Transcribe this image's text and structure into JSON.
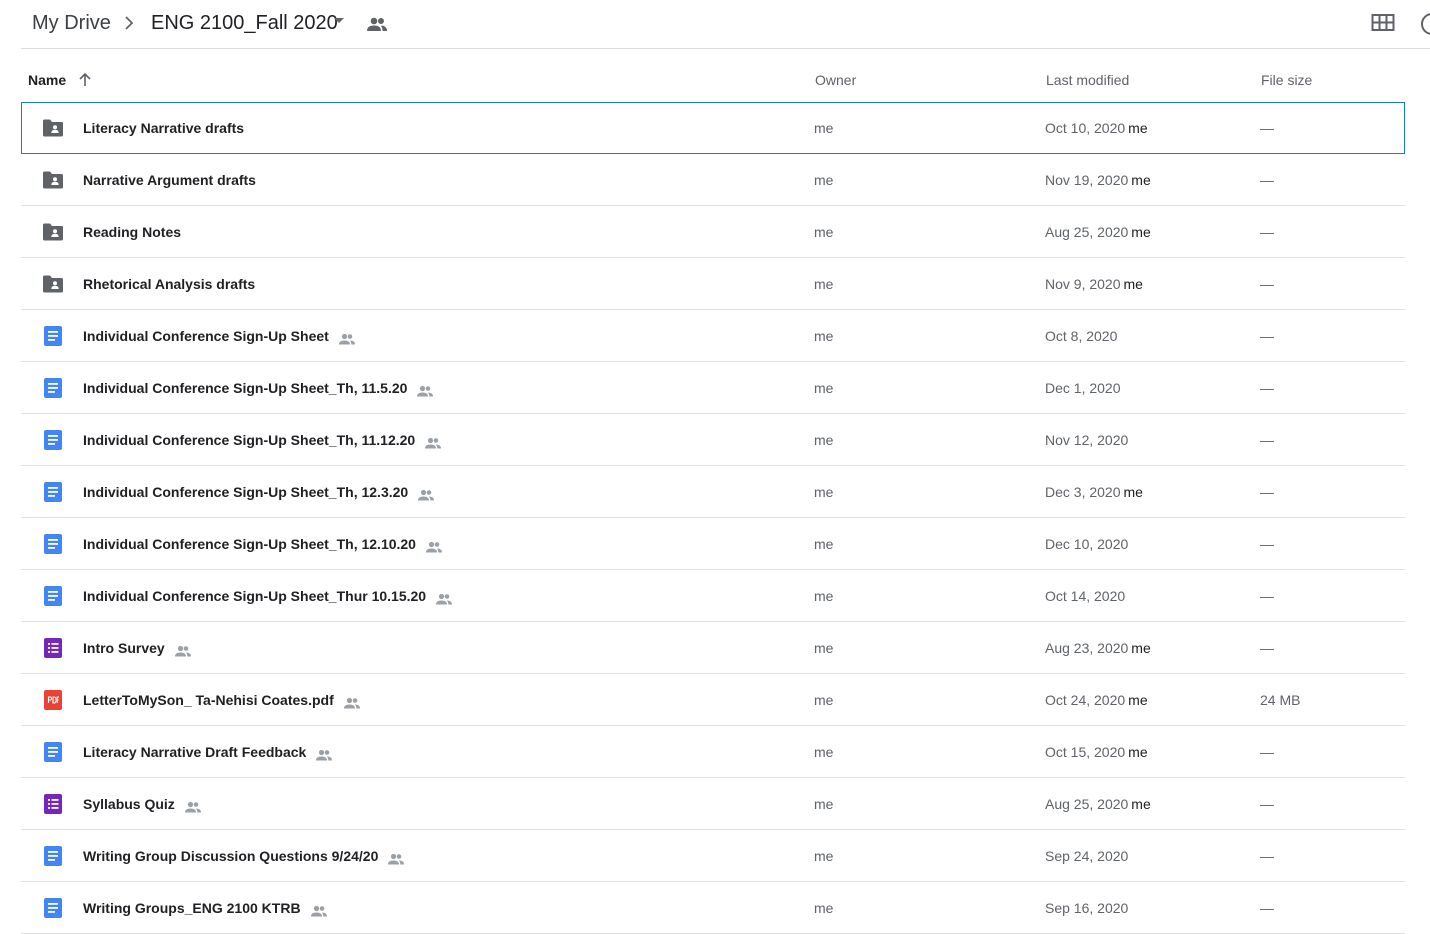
{
  "breadcrumb": {
    "root": "My Drive",
    "current": "ENG 2100_Fall 2020"
  },
  "columns": {
    "name": "Name",
    "owner": "Owner",
    "modified": "Last modified",
    "size": "File size"
  },
  "colors": {
    "accent": "#1a73e8",
    "doc": "#4285f4",
    "form": "#7627bb",
    "pdf": "#ea4335",
    "folder": "#5f6368"
  },
  "files": [
    {
      "type": "folder-shared-icon",
      "name": "Literacy Narrative drafts",
      "shared": false,
      "owner": "me",
      "modified": "Oct 10, 2020",
      "modified_by": "me",
      "size": "—",
      "selected": true
    },
    {
      "type": "folder-shared-icon",
      "name": "Narrative Argument drafts",
      "shared": false,
      "owner": "me",
      "modified": "Nov 19, 2020",
      "modified_by": "me",
      "size": "—"
    },
    {
      "type": "folder-shared-icon",
      "name": "Reading Notes",
      "shared": false,
      "owner": "me",
      "modified": "Aug 25, 2020",
      "modified_by": "me",
      "size": "—"
    },
    {
      "type": "folder-shared-icon",
      "name": "Rhetorical Analysis drafts",
      "shared": false,
      "owner": "me",
      "modified": "Nov 9, 2020",
      "modified_by": "me",
      "size": "—"
    },
    {
      "type": "google-doc-icon",
      "name": "Individual Conference Sign-Up Sheet",
      "shared": true,
      "owner": "me",
      "modified": "Oct 8, 2020",
      "modified_by": "",
      "size": "—"
    },
    {
      "type": "google-doc-icon",
      "name": "Individual Conference Sign-Up Sheet_Th, 11.5.20",
      "shared": true,
      "owner": "me",
      "modified": "Dec 1, 2020",
      "modified_by": "",
      "size": "—"
    },
    {
      "type": "google-doc-icon",
      "name": "Individual Conference Sign-Up Sheet_Th, 11.12.20",
      "shared": true,
      "owner": "me",
      "modified": "Nov 12, 2020",
      "modified_by": "",
      "size": "—"
    },
    {
      "type": "google-doc-icon",
      "name": "Individual Conference Sign-Up Sheet_Th, 12.3.20",
      "shared": true,
      "owner": "me",
      "modified": "Dec 3, 2020",
      "modified_by": "me",
      "size": "—"
    },
    {
      "type": "google-doc-icon",
      "name": "Individual Conference Sign-Up Sheet_Th, 12.10.20",
      "shared": true,
      "owner": "me",
      "modified": "Dec 10, 2020",
      "modified_by": "",
      "size": "—"
    },
    {
      "type": "google-doc-icon",
      "name": "Individual Conference Sign-Up Sheet_Thur 10.15.20",
      "shared": true,
      "owner": "me",
      "modified": "Oct 14, 2020",
      "modified_by": "",
      "size": "—"
    },
    {
      "type": "google-form-icon",
      "name": "Intro Survey",
      "shared": true,
      "owner": "me",
      "modified": "Aug 23, 2020",
      "modified_by": "me",
      "size": "—"
    },
    {
      "type": "pdf-icon",
      "name": "LetterToMySon_ Ta-Nehisi Coates.pdf",
      "shared": true,
      "owner": "me",
      "modified": "Oct 24, 2020",
      "modified_by": "me",
      "size": "24 MB"
    },
    {
      "type": "google-doc-icon",
      "name": "Literacy Narrative Draft Feedback",
      "shared": true,
      "owner": "me",
      "modified": "Oct 15, 2020",
      "modified_by": "me",
      "size": "—"
    },
    {
      "type": "google-form-icon",
      "name": "Syllabus Quiz",
      "shared": true,
      "owner": "me",
      "modified": "Aug 25, 2020",
      "modified_by": "me",
      "size": "—"
    },
    {
      "type": "google-doc-icon",
      "name": "Writing Group Discussion Questions 9/24/20",
      "shared": true,
      "owner": "me",
      "modified": "Sep 24, 2020",
      "modified_by": "",
      "size": "—"
    },
    {
      "type": "google-doc-icon",
      "name": "Writing Groups_ENG 2100 KTRB",
      "shared": true,
      "owner": "me",
      "modified": "Sep 16, 2020",
      "modified_by": "",
      "size": "—"
    }
  ]
}
